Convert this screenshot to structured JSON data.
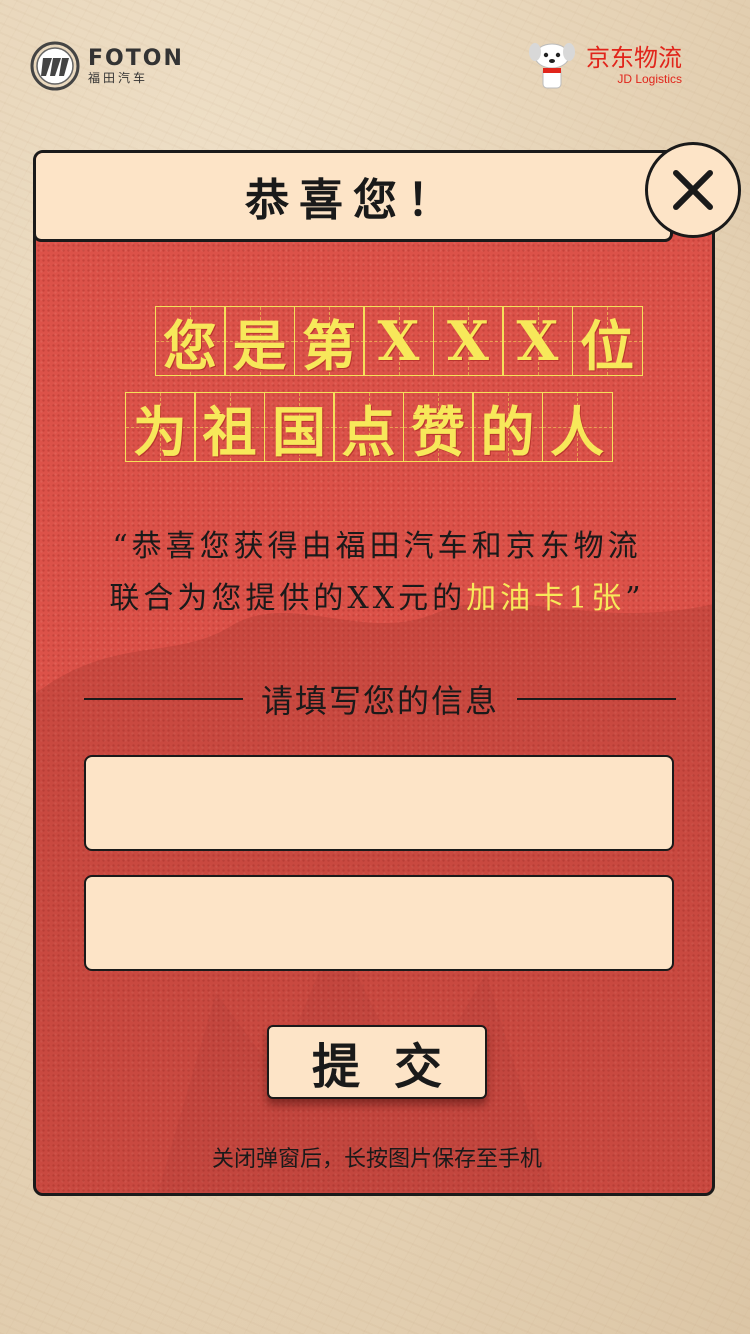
{
  "header": {
    "foton": {
      "name": "FOTON",
      "sub": "福田汽车"
    },
    "jd": {
      "name": "京东物流",
      "sub": "JD Logistics"
    }
  },
  "modal": {
    "title": "恭喜您！",
    "close_symbol": "✕",
    "headline_row1": [
      "您",
      "是",
      "第",
      "X",
      "X",
      "X",
      "位"
    ],
    "headline_row2": [
      "为",
      "祖",
      "国",
      "点",
      "赞",
      "的",
      "人"
    ],
    "desc_line1": "“恭喜您获得由福田汽车和京东物流",
    "desc_line2_prefix": "联合为您提供的XX元的",
    "desc_line2_highlight": "加油卡1张",
    "desc_line2_suffix": "”",
    "form_heading": "请填写您的信息",
    "field1_value": "",
    "field2_value": "",
    "submit_label": "提交",
    "tip": "关闭弹窗后，长按图片保存至手机"
  },
  "colors": {
    "modal_red": "#dc5249",
    "cream": "#fde4c7",
    "highlight_yellow": "#f7e85a",
    "jd_red": "#e1251b"
  },
  "icons": [
    "foton-logo-icon",
    "jd-dog-icon",
    "close-icon"
  ]
}
